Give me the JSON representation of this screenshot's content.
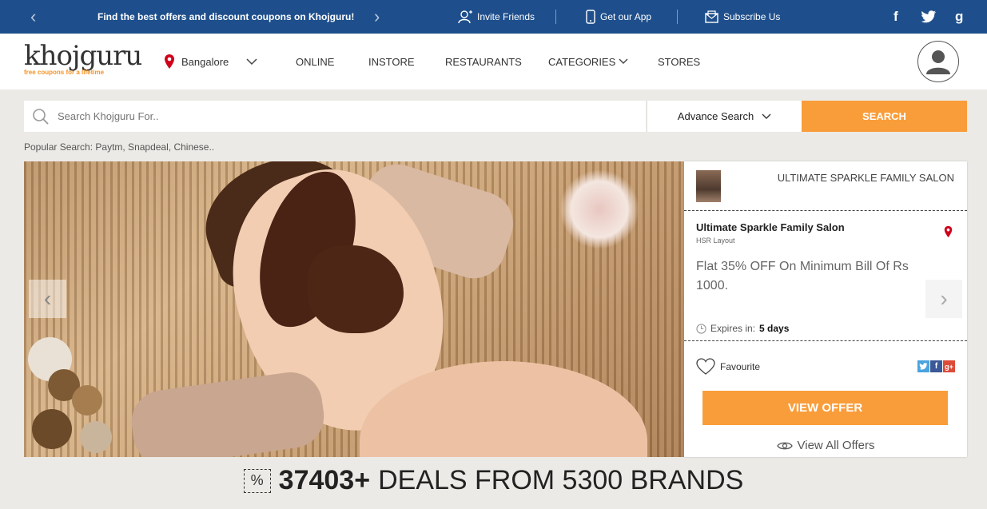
{
  "topbar": {
    "promo": "Find the best offers and discount coupons on Khojguru!",
    "prev_arrow": "‹",
    "next_arrow": "›",
    "invite": "Invite Friends",
    "app": "Get our App",
    "subscribe": "Subscribe Us",
    "social": {
      "facebook": "f",
      "google": "g"
    }
  },
  "header": {
    "logo_word": "khojguru",
    "logo_tag": "free coupons for a lifetime",
    "city": "Bangalore",
    "nav": [
      "ONLINE",
      "INSTORE",
      "RESTAURANTS",
      "CATEGORIES",
      "STORES"
    ]
  },
  "search": {
    "placeholder": "Search Khojguru For..",
    "advance": "Advance Search",
    "button": "SEARCH",
    "popular": "Popular Search: Paytm, Snapdeal, Chinese.."
  },
  "offer": {
    "merchant_header": "ULTIMATE SPARKLE FAMILY SALON",
    "store_name": "Ultimate Sparkle Family Salon",
    "location": "HSR Layout",
    "description": "Flat 35% OFF On Minimum Bill Of Rs 1000.",
    "expires_label": "Expires in:",
    "expires_value": "5 days",
    "favourite": "Favourite",
    "share": {
      "facebook": "f",
      "google": "g+"
    },
    "view_offer": "VIEW OFFER",
    "view_all": "View All Offers"
  },
  "hero": {
    "prev_arrow": "‹",
    "next_arrow": "›"
  },
  "stats": {
    "icon_glyph": "%",
    "count": "37403+",
    "text": "DEALS FROM 5300 BRANDS"
  },
  "colors": {
    "topbar": "#1e4f8c",
    "accent": "#f99d3a",
    "pin": "#d0021b"
  }
}
